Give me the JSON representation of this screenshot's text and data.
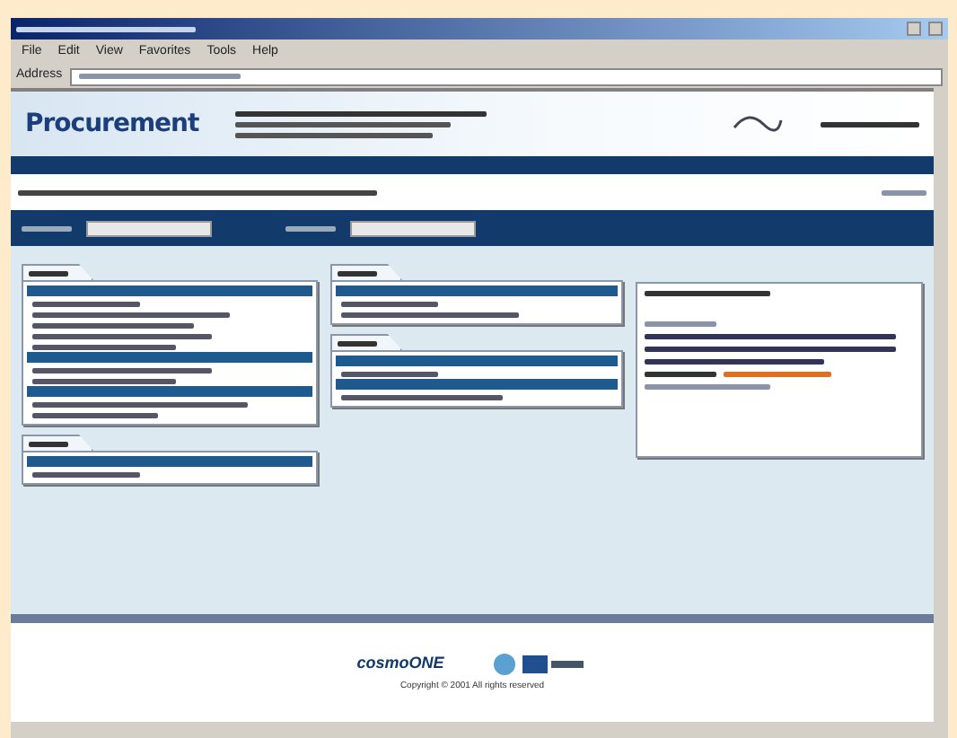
{
  "menu_bar": [
    "File",
    "Edit",
    "View",
    "Favorites",
    "Tools",
    "Help"
  ],
  "address_bar": {
    "label": "Address"
  },
  "banner": {
    "product": "Procurement"
  },
  "left_column": [
    {
      "tab": {
        "kind": "illegible"
      },
      "sections": [
        {
          "items": [
            {
              "kind": "illegible"
            },
            {
              "kind": "illegible"
            },
            {
              "kind": "illegible"
            },
            {
              "kind": "illegible"
            },
            {
              "kind": "illegible"
            }
          ]
        },
        {
          "items": [
            {
              "kind": "illegible"
            },
            {
              "kind": "illegible"
            }
          ]
        },
        {
          "items": [
            {
              "kind": "illegible"
            },
            {
              "kind": "illegible"
            }
          ]
        }
      ]
    },
    {
      "tab": {
        "kind": "illegible"
      },
      "sections": [
        {
          "items": [
            {
              "kind": "illegible"
            }
          ]
        }
      ]
    }
  ],
  "middle_column": [
    {
      "tab": {
        "kind": "illegible"
      },
      "sections": [
        {
          "items": [
            {
              "kind": "illegible"
            },
            {
              "kind": "illegible"
            }
          ]
        }
      ]
    },
    {
      "tab": {
        "kind": "illegible"
      },
      "sections": [
        {
          "items": [
            {
              "kind": "illegible"
            }
          ]
        },
        {
          "items": [
            {
              "kind": "illegible"
            }
          ]
        }
      ]
    }
  ],
  "footer": {
    "brand": "cosmoONE",
    "copyright": "Copyright © 2001 All rights reserved"
  }
}
